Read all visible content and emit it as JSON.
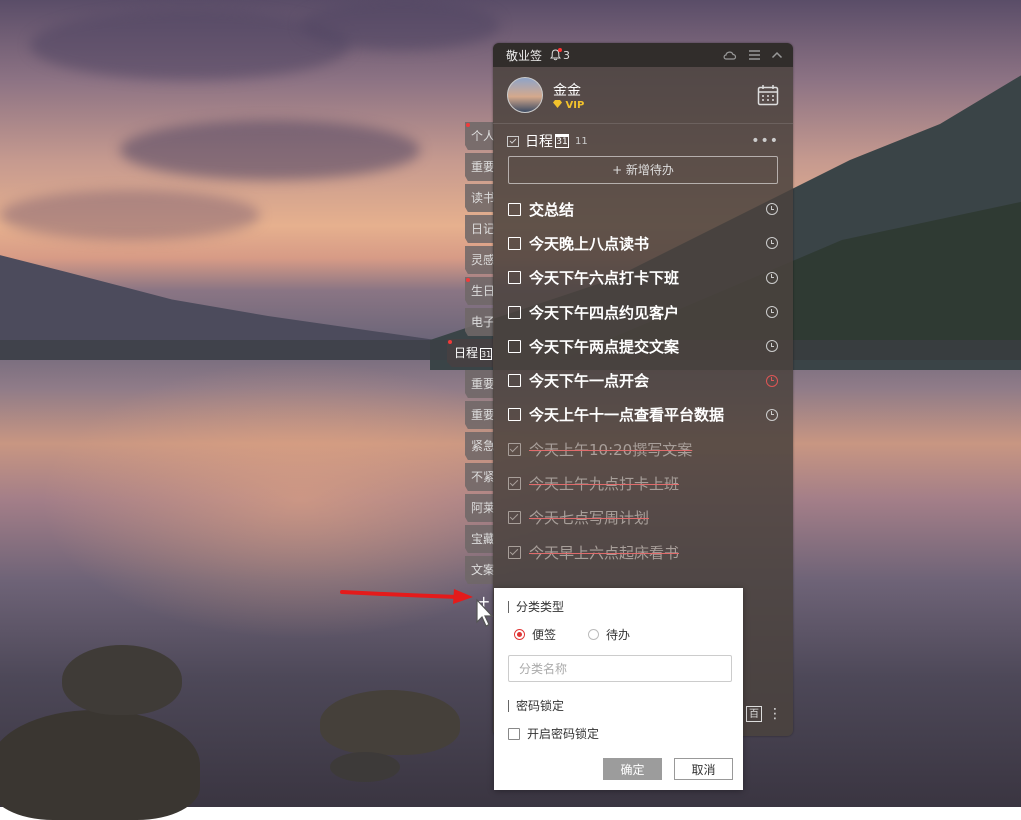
{
  "app": {
    "title": "敬业签",
    "notification_count": "3"
  },
  "user": {
    "name": "金金",
    "badge": "VIP"
  },
  "side_tabs": [
    {
      "label": "个人",
      "dot": true
    },
    {
      "label": "重要",
      "dot": false
    },
    {
      "label": "读书",
      "dot": false
    },
    {
      "label": "日记",
      "dot": false
    },
    {
      "label": "灵感",
      "dot": false
    },
    {
      "label": "生日",
      "dot": true
    },
    {
      "label": "电子",
      "dot": false
    },
    {
      "label": "日程",
      "dot": true,
      "active": true,
      "cal_icon_text": "31"
    },
    {
      "label": "重要",
      "dot": false
    },
    {
      "label": "重要",
      "dot": false
    },
    {
      "label": "紧急",
      "dot": false
    },
    {
      "label": "不紧",
      "dot": false
    },
    {
      "label": "阿莱",
      "dot": false
    },
    {
      "label": "宝藏",
      "dot": false
    },
    {
      "label": "文案",
      "dot": false
    }
  ],
  "side_add_label": "+",
  "list": {
    "title": "日程",
    "cal_icon_text": "31",
    "count": "11",
    "more_label": "•••",
    "add_button": "+ 新增待办"
  },
  "todos": [
    {
      "text": "交总结",
      "done": false,
      "clock": "normal"
    },
    {
      "text": "今天晚上八点读书",
      "done": false,
      "clock": "normal"
    },
    {
      "text": "今天下午六点打卡下班",
      "done": false,
      "clock": "normal"
    },
    {
      "text": "今天下午四点约见客户",
      "done": false,
      "clock": "normal"
    },
    {
      "text": "今天下午两点提交文案",
      "done": false,
      "clock": "normal"
    },
    {
      "text": "今天下午一点开会",
      "done": false,
      "clock": "red"
    },
    {
      "text": "今天上午十一点查看平台数据",
      "done": false,
      "clock": "normal"
    },
    {
      "text": "今天上午10:20撰写文案",
      "done": true,
      "clock": "none"
    },
    {
      "text": "今天上午九点打卡上班",
      "done": true,
      "clock": "none"
    },
    {
      "text": "今天七点写周计划",
      "done": true,
      "clock": "none"
    },
    {
      "text": "今天早上六点起床看书",
      "done": true,
      "clock": "none"
    }
  ],
  "bottom": {
    "box_icon_text": "百",
    "more_label": "⋮"
  },
  "dialog": {
    "category_type_label": "分类类型",
    "option_note": "便签",
    "option_todo": "待办",
    "selected": "便签",
    "name_placeholder": "分类名称",
    "name_value": "",
    "lock_section_label": "密码锁定",
    "lock_checkbox_label": "开启密码锁定",
    "lock_checked": false,
    "confirm_label": "确定",
    "cancel_label": "取消"
  },
  "colors": {
    "accent_red": "#e03535",
    "panel_bg": "#4a423e",
    "vip_gold": "#f2c22c"
  }
}
